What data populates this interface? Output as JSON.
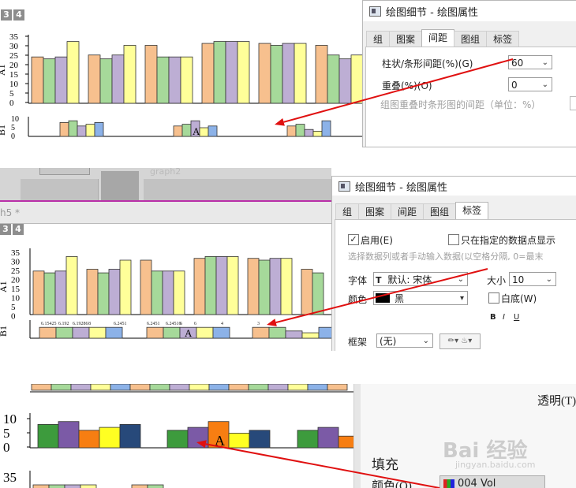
{
  "layer_tabs": [
    "3",
    "4"
  ],
  "axis_labels": {
    "a1": "A1",
    "b1": "B1"
  },
  "y_ticks_top": [
    "35",
    "30",
    "25",
    "20",
    "15",
    "10",
    "5",
    "0"
  ],
  "y_ticks_small": [
    "10",
    "5",
    "0"
  ],
  "bar_label_A": "A",
  "panel1": {
    "dialog_title": "绘图细节 - 绘图属性",
    "tabs": [
      "组",
      "图案",
      "间距",
      "图组",
      "标签"
    ],
    "active_tab": "间距",
    "gap_label": "柱状/条形间距(%)(G)",
    "gap_value": "60",
    "overlap_label": "重叠(%)(O)",
    "overlap_value": "0",
    "note": "组图重叠时条形图的间距（单位：%）"
  },
  "panel2": {
    "dialog_title": "绘图细节 - 绘图属性",
    "tabs": [
      "组",
      "图案",
      "间距",
      "图组",
      "标签"
    ],
    "active_tab": "标签",
    "window_tab_text": "graph2",
    "graph_tab_text": "h5 *",
    "enable_label": "启用(E)",
    "only_selected_label": "只在指定的数据点显示",
    "select_hint": "选择数据列或者手动输入数据(以空格分隔, 0=最末",
    "font_label": "字体",
    "font_value": "默认: 宋体",
    "size_label": "大小",
    "size_value": "10",
    "color_label": "颜色",
    "color_value": "黑",
    "white_bg_label": "白底(W)",
    "bold": "B",
    "italic": "I",
    "underline": "U",
    "frame_label": "框架",
    "frame_value": "(无)",
    "data_labels": [
      "6.15425",
      "6.192",
      "6.19286",
      "8",
      "6.2451",
      "6.2451",
      "6.24516",
      "6",
      "6",
      "4",
      "3"
    ]
  },
  "panel3": {
    "transparency_label": "透明(T)",
    "fill_label": "填充",
    "color_field_label": "颜色(O)",
    "color_value": "004 Vol",
    "watermark": "Bai 经验",
    "watermark_url": "jingyan.baidu.com"
  },
  "colors": {
    "peach": "#f7c08e",
    "green": "#a6d99a",
    "lavender": "#bdaed4",
    "yellow": "#ffff99",
    "blue": "#8cb2e8",
    "dark_green": "#3d9b3d",
    "purple": "#7b5aa6",
    "orange": "#f77e12",
    "bright_yellow": "#ffff22",
    "navy": "#27497a",
    "arrow": "#e01010"
  }
}
